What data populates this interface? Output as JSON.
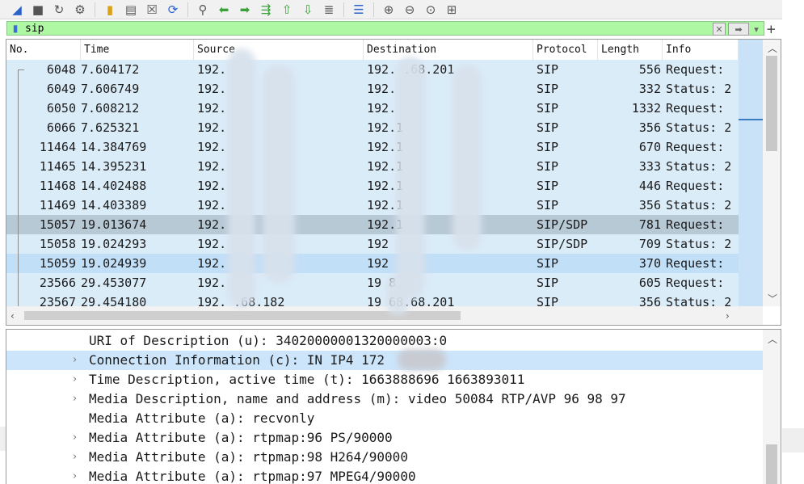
{
  "toolbar": {
    "icons": [
      "shark-fin-icon",
      "stop-icon",
      "restart-icon",
      "options-gear-icon",
      "open-folder-icon",
      "save-file-icon",
      "close-file-icon",
      "reload-icon",
      "find-icon",
      "back-arrow-icon",
      "forward-arrow-icon",
      "go-to-packet-icon",
      "first-packet-icon",
      "last-packet-icon",
      "autoscroll-icon",
      "colorize-icon",
      "zoom-in-icon",
      "zoom-out-icon",
      "normal-size-icon",
      "resize-columns-icon"
    ]
  },
  "filter": {
    "value": "sip"
  },
  "columns": [
    "No.",
    "Time",
    "Source",
    "Destination",
    "Protocol",
    "Length",
    "Info"
  ],
  "packets": [
    {
      "no": "6048",
      "time": "7.604172",
      "src": "192.",
      "dst": "192.  .68.201",
      "proto": "SIP",
      "len": "556",
      "info": "Request:"
    },
    {
      "no": "6049",
      "time": "7.606749",
      "src": "192.",
      "dst": "192.",
      "proto": "SIP",
      "len": "332",
      "info": "Status: 2"
    },
    {
      "no": "6050",
      "time": "7.608212",
      "src": "192.",
      "dst": "192.",
      "proto": "SIP",
      "len": "1332",
      "info": "Request:"
    },
    {
      "no": "6066",
      "time": "7.625321",
      "src": "192.",
      "dst": "192.1",
      "proto": "SIP",
      "len": "356",
      "info": "Status: 2"
    },
    {
      "no": "11464",
      "time": "14.384769",
      "src": "192.",
      "dst": "192.1",
      "proto": "SIP",
      "len": "670",
      "info": "Request:"
    },
    {
      "no": "11465",
      "time": "14.395231",
      "src": "192.",
      "dst": "192.1",
      "proto": "SIP",
      "len": "333",
      "info": "Status: 2"
    },
    {
      "no": "11468",
      "time": "14.402488",
      "src": "192.",
      "dst": "192.1",
      "proto": "SIP",
      "len": "446",
      "info": "Request:"
    },
    {
      "no": "11469",
      "time": "14.403389",
      "src": "192.",
      "dst": "192.1",
      "proto": "SIP",
      "len": "356",
      "info": "Status: 2"
    },
    {
      "no": "15057",
      "time": "19.013674",
      "src": "192.",
      "dst": "192.1",
      "proto": "SIP/SDP",
      "len": "781",
      "info": "Request:"
    },
    {
      "no": "15058",
      "time": "19.024293",
      "src": "192.",
      "dst": "192",
      "proto": "SIP/SDP",
      "len": "709",
      "info": "Status: 2"
    },
    {
      "no": "15059",
      "time": "19.024939",
      "src": "192.",
      "dst": "192",
      "proto": "SIP",
      "len": "370",
      "info": "Request:"
    },
    {
      "no": "23566",
      "time": "29.453077",
      "src": "192.",
      "dst": "19  8.",
      "proto": "SIP",
      "len": "605",
      "info": "Request:"
    },
    {
      "no": "23567",
      "time": "29.454180",
      "src": "192.  .68.182",
      "dst": "19  68.68.201",
      "proto": "SIP",
      "len": "356",
      "info": "Status: 2"
    }
  ],
  "details": [
    {
      "caret": "",
      "text": "URI of Description (u): 34020000001320000003:0"
    },
    {
      "caret": "›",
      "text": "Connection Information (c): IN IP4 172"
    },
    {
      "caret": "›",
      "text": "Time Description, active time (t): 1663888696 1663893011"
    },
    {
      "caret": "›",
      "text": "Media Description, name and address (m): video 50084 RTP/AVP 96 98 97"
    },
    {
      "caret": "",
      "text": "Media Attribute (a): recvonly"
    },
    {
      "caret": "›",
      "text": "Media Attribute (a): rtpmap:96 PS/90000"
    },
    {
      "caret": "›",
      "text": "Media Attribute (a): rtpmap:98 H264/90000"
    },
    {
      "caret": "›",
      "text": "Media Attribute (a): rtpmap:97 MPEG4/90000"
    }
  ]
}
